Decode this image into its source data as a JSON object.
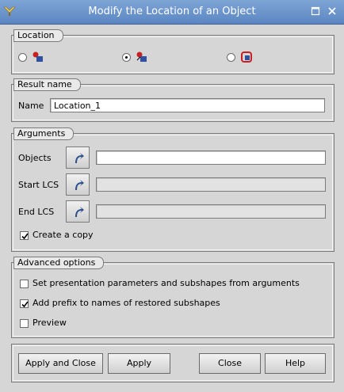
{
  "window": {
    "title": "Modify the Location of an Object",
    "icon": "salome-app-icon"
  },
  "location": {
    "header": "Location",
    "options": [
      {
        "icon": "location-absolute-icon",
        "selected": false
      },
      {
        "icon": "location-relative-icon",
        "selected": true
      },
      {
        "icon": "location-path-icon",
        "selected": false
      }
    ]
  },
  "result": {
    "header": "Result name",
    "name_label": "Name",
    "name_value": "Location_1"
  },
  "arguments": {
    "header": "Arguments",
    "objects_label": "Objects",
    "start_lcs_label": "Start LCS",
    "end_lcs_label": "End LCS",
    "objects_value": "",
    "start_lcs_value": "",
    "end_lcs_value": "",
    "create_copy_label": "Create a copy",
    "create_copy_checked": true
  },
  "advanced": {
    "header": "Advanced options",
    "set_presentation_label": "Set presentation parameters and subshapes from arguments",
    "set_presentation_checked": false,
    "add_prefix_label": "Add prefix to names of restored subshapes",
    "add_prefix_checked": true,
    "preview_label": "Preview",
    "preview_checked": false
  },
  "buttons": {
    "apply_close": "Apply and Close",
    "apply": "Apply",
    "close": "Close",
    "help": "Help"
  },
  "colors": {
    "titlebar": "#6b93c9",
    "background": "#d6d6d6"
  }
}
